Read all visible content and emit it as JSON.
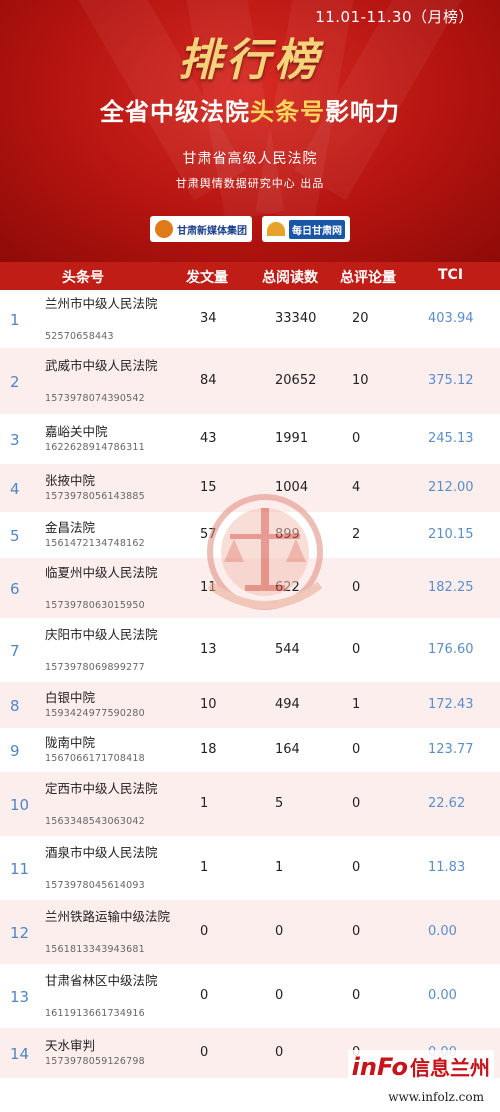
{
  "header": {
    "date_range": "11.01-11.30（月榜）",
    "rank_title": "排行榜",
    "title_pre": "全省",
    "title_mid": "中级法院",
    "title_hl": "头条号",
    "title_post": "影响力",
    "issuer": "甘肃省高级人民法院",
    "producer": "甘肃舆情数据研究中心 出品",
    "logo1_text": "甘肃新媒体集团",
    "logo2_text": "每日甘肃网"
  },
  "table": {
    "columns": [
      "头条号",
      "发文量",
      "总阅读数",
      "总评论量",
      "TCI"
    ],
    "rows": [
      {
        "rank": "1",
        "name": "兰州市中级人民法院",
        "account": "52570658443",
        "posts": "34",
        "reads": "33340",
        "comments": "20",
        "tci": "403.94"
      },
      {
        "rank": "2",
        "name": "武威市中级人民法院",
        "account": "1573978074390542",
        "posts": "84",
        "reads": "20652",
        "comments": "10",
        "tci": "375.12"
      },
      {
        "rank": "3",
        "name": "嘉峪关中院",
        "account": "1622628914786311",
        "posts": "43",
        "reads": "1991",
        "comments": "0",
        "tci": "245.13"
      },
      {
        "rank": "4",
        "name": "张掖中院",
        "account": "1573978056143885",
        "posts": "15",
        "reads": "1004",
        "comments": "4",
        "tci": "212.00"
      },
      {
        "rank": "5",
        "name": "金昌法院",
        "account": "1561472134748162",
        "posts": "57",
        "reads": "899",
        "comments": "2",
        "tci": "210.15"
      },
      {
        "rank": "6",
        "name": "临夏州中级人民法院",
        "account": "1573978063015950",
        "posts": "11",
        "reads": "622",
        "comments": "0",
        "tci": "182.25"
      },
      {
        "rank": "7",
        "name": "庆阳市中级人民法院",
        "account": "1573978069899277",
        "posts": "13",
        "reads": "544",
        "comments": "0",
        "tci": "176.60"
      },
      {
        "rank": "8",
        "name": "白银中院",
        "account": "1593424977590280",
        "posts": "10",
        "reads": "494",
        "comments": "1",
        "tci": "172.43"
      },
      {
        "rank": "9",
        "name": "陇南中院",
        "account": "1567066171708418",
        "posts": "18",
        "reads": "164",
        "comments": "0",
        "tci": "123.77"
      },
      {
        "rank": "10",
        "name": "定西市中级人民法院",
        "account": "1563348543063042",
        "posts": "1",
        "reads": "5",
        "comments": "0",
        "tci": "22.62"
      },
      {
        "rank": "11",
        "name": "酒泉市中级人民法院",
        "account": "1573978045614093",
        "posts": "1",
        "reads": "1",
        "comments": "0",
        "tci": "11.83"
      },
      {
        "rank": "12",
        "name": "兰州铁路运输中级法院",
        "account": "1561813343943681",
        "posts": "0",
        "reads": "0",
        "comments": "0",
        "tci": "0.00"
      },
      {
        "rank": "13",
        "name": "甘肃省林区中级法院",
        "account": "1611913661734916",
        "posts": "0",
        "reads": "0",
        "comments": "0",
        "tci": "0.00"
      },
      {
        "rank": "14",
        "name": "天水审判",
        "account": "1573978059126798",
        "posts": "0",
        "reads": "0",
        "comments": "0",
        "tci": "0.00"
      }
    ]
  },
  "watermark": {
    "brand_latin": "inFo",
    "brand_cn": "信息兰州",
    "url": "www.infolz.com"
  },
  "colors": {
    "header_red": "#b51410",
    "gold": "#f6d37a",
    "highlight_yellow": "#f8d65a",
    "rank_blue": "#4f86c6",
    "tci_blue": "#5b8ec9",
    "alt_row": "#fdeeee"
  },
  "icons": [
    "court-emblem-icon",
    "media-group-logo-icon",
    "daily-gansu-logo-icon"
  ]
}
